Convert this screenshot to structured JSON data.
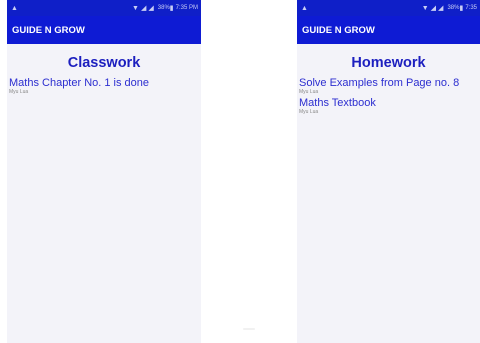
{
  "status_bar": {
    "left": {
      "warning_icon": "warning-triangle-icon",
      "time": "7:35 PM",
      "battery_text": "38%"
    },
    "right": {
      "warning_icon": "warning-triangle-icon",
      "time": "7:35",
      "battery_text": "38%"
    }
  },
  "left_screen": {
    "app_title": "GUIDE N GROW",
    "heading": "Classwork",
    "entries": [
      {
        "title": "Maths Chapter No. 1 is done",
        "author": "Myu Lua"
      }
    ]
  },
  "right_screen": {
    "app_title": "GUIDE N GROW",
    "heading": "Homework",
    "entries": [
      {
        "title": "Solve Examples from Page no. 8",
        "author": "Myu Lua"
      },
      {
        "title": "Maths Textbook",
        "author": "Myu Lua"
      }
    ]
  },
  "colors": {
    "app_bar": "#0e1bd4",
    "heading": "#1c1fbf",
    "entry_title": "#2c2ed0",
    "screen_bg": "#f3f3f9"
  }
}
